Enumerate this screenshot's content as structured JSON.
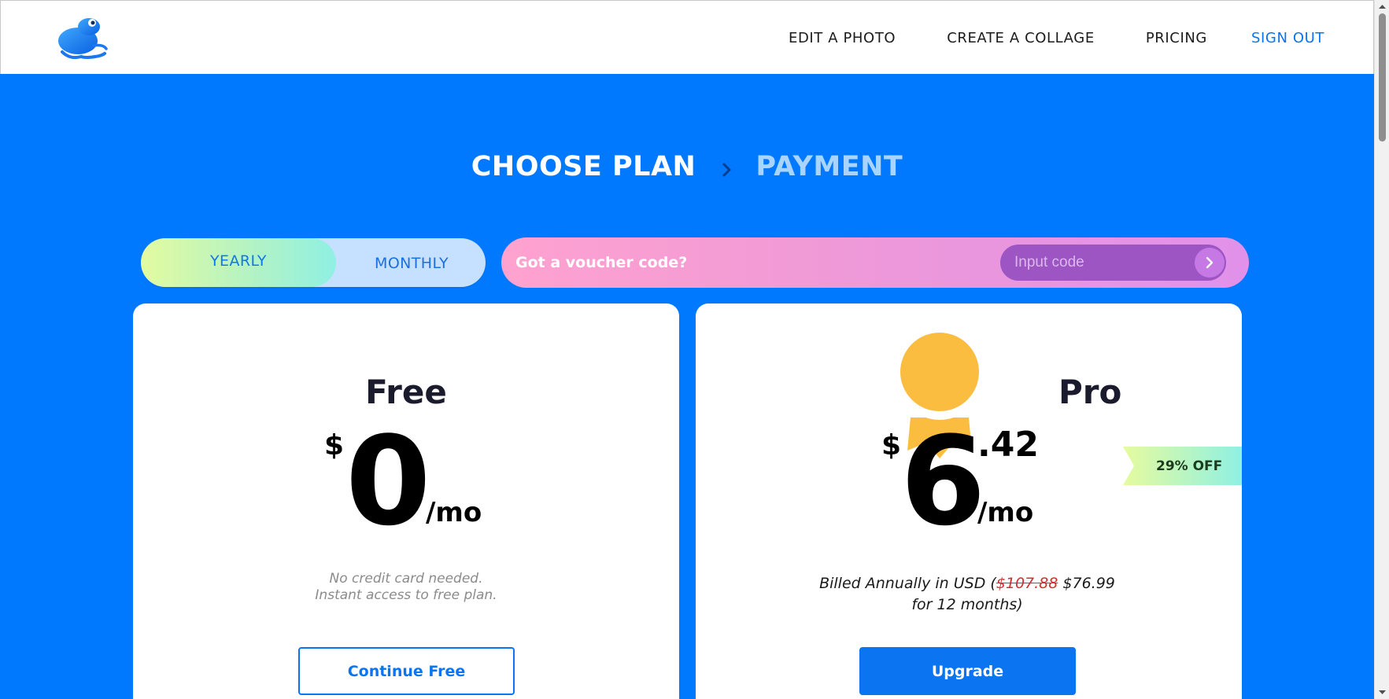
{
  "header": {
    "nav": [
      {
        "label": "EDIT A PHOTO"
      },
      {
        "label": "CREATE A COLLAGE"
      },
      {
        "label": "PRICING"
      },
      {
        "label": "SIGN OUT"
      }
    ],
    "logo_icon": "frog-logo-icon"
  },
  "steps": {
    "current": "CHOOSE PLAN",
    "next": "PAYMENT",
    "separator_icon": "chevron-right-icon"
  },
  "billing_toggle": {
    "yearly": "YEARLY",
    "monthly": "MONTHLY",
    "selected": "YEARLY"
  },
  "voucher": {
    "label": "Got a voucher code?",
    "placeholder": "Input code",
    "value": "",
    "submit_icon": "chevron-right-icon"
  },
  "plans": {
    "free": {
      "name": "Free",
      "currency": "$",
      "price": "0",
      "period": "/mo",
      "note_line1": "No credit card needed.",
      "note_line2": "Instant access to free plan.",
      "button": "Continue Free"
    },
    "pro": {
      "name": "Pro",
      "currency": "$",
      "price": "6",
      "cents": ".42",
      "period": "/mo",
      "discount_badge": "29% OFF",
      "billed_prefix": "Billed Annually in USD (",
      "original_price": "$107.88",
      "billed_price": " $76.99",
      "billed_suffix": "for 12 months)",
      "button": "Upgrade",
      "medal_icon": "award-medal-icon"
    }
  },
  "colors": {
    "brand_blue": "#0179ff",
    "button_blue": "#0b74f0",
    "medal_yellow": "#fbbd3f",
    "strike_red": "#d42e2e"
  }
}
